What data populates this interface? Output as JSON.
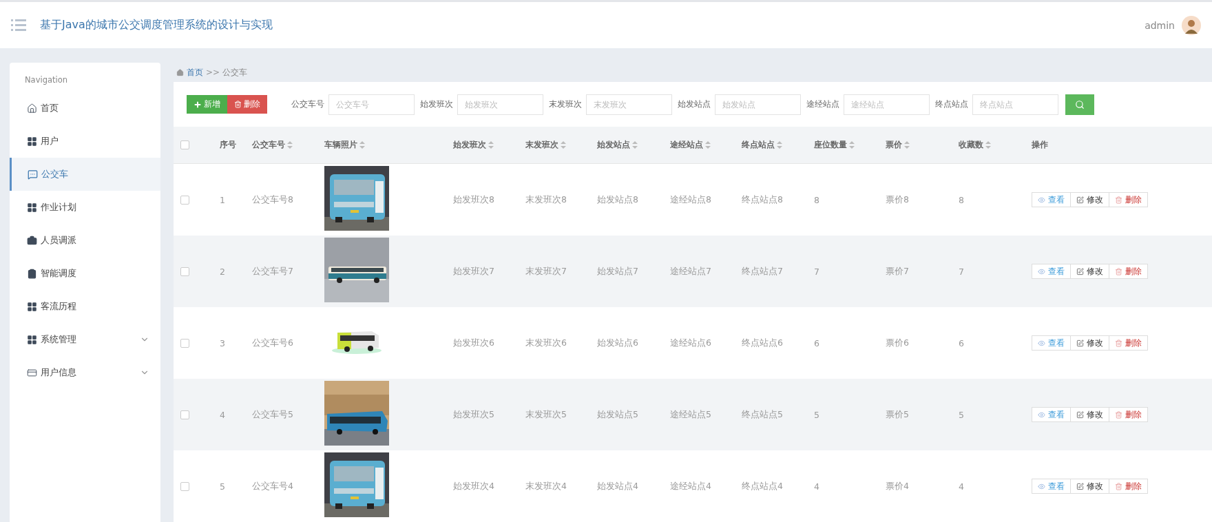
{
  "header": {
    "title": "基于Java的城市公交调度管理系统的设计与实现",
    "user": "admin"
  },
  "sidebar": {
    "heading": "Navigation",
    "items": [
      {
        "label": "首页",
        "selected": false,
        "expandable": false
      },
      {
        "label": "用户",
        "selected": false,
        "expandable": false
      },
      {
        "label": "公交车",
        "selected": true,
        "expandable": false
      },
      {
        "label": "作业计划",
        "selected": false,
        "expandable": false
      },
      {
        "label": "人员调派",
        "selected": false,
        "expandable": false
      },
      {
        "label": "智能调度",
        "selected": false,
        "expandable": false
      },
      {
        "label": "客流历程",
        "selected": false,
        "expandable": false
      },
      {
        "label": "系统管理",
        "selected": false,
        "expandable": true
      },
      {
        "label": "用户信息",
        "selected": false,
        "expandable": true
      }
    ]
  },
  "breadcrumb": {
    "home": "首页",
    "separator": ">>",
    "current": "公交车"
  },
  "toolbar": {
    "add": "新增",
    "delete": "删除",
    "filters": [
      {
        "label": "公交车号",
        "placeholder": "公交车号"
      },
      {
        "label": "始发班次",
        "placeholder": "始发班次"
      },
      {
        "label": "末发班次",
        "placeholder": "末发班次"
      },
      {
        "label": "始发站点",
        "placeholder": "始发站点"
      },
      {
        "label": "途经站点",
        "placeholder": "途经站点"
      },
      {
        "label": "终点站点",
        "placeholder": "终点站点"
      }
    ]
  },
  "table": {
    "select_all": {
      "checked": false
    },
    "columns": [
      {
        "label": "序号",
        "sortable": false
      },
      {
        "label": "公交车号",
        "sortable": true
      },
      {
        "label": "车辆照片",
        "sortable": true
      },
      {
        "label": "始发班次",
        "sortable": true
      },
      {
        "label": "末发班次",
        "sortable": true
      },
      {
        "label": "始发站点",
        "sortable": true
      },
      {
        "label": "途经站点",
        "sortable": true
      },
      {
        "label": "终点站点",
        "sortable": true
      },
      {
        "label": "座位数量",
        "sortable": true
      },
      {
        "label": "票价",
        "sortable": true
      },
      {
        "label": "收藏数",
        "sortable": true
      },
      {
        "label": "操作",
        "sortable": false
      }
    ],
    "rows": [
      {
        "checked": false,
        "cells": [
          "1",
          "公交车号8",
          {
            "kind": "picture"
          },
          "始发班次8",
          "末发班次8",
          "始发站点8",
          "途经站点8",
          "终点站点8",
          "8",
          "票价8",
          "8"
        ],
        "actions": [
          "查看",
          "修改",
          "删除"
        ]
      },
      {
        "checked": false,
        "cells": [
          "2",
          "公交车号7",
          {
            "kind": "picture"
          },
          "始发班次7",
          "末发班次7",
          "始发站点7",
          "途经站点7",
          "终点站点7",
          "7",
          "票价7",
          "7"
        ],
        "actions": [
          "查看",
          "修改",
          "删除"
        ]
      },
      {
        "checked": false,
        "cells": [
          "3",
          "公交车号6",
          {
            "kind": "picture"
          },
          "始发班次6",
          "末发班次6",
          "始发站点6",
          "途经站点6",
          "终点站点6",
          "6",
          "票价6",
          "6"
        ],
        "actions": [
          "查看",
          "修改",
          "删除"
        ]
      },
      {
        "checked": false,
        "cells": [
          "4",
          "公交车号5",
          {
            "kind": "picture"
          },
          "始发班次5",
          "末发班次5",
          "始发站点5",
          "途经站点5",
          "终点站点5",
          "5",
          "票价5",
          "5"
        ],
        "actions": [
          "查看",
          "修改",
          "删除"
        ]
      },
      {
        "checked": false,
        "cells": [
          "5",
          "公交车号4",
          {
            "kind": "picture"
          },
          "始发班次4",
          "末发班次4",
          "始发站点4",
          "途经站点4",
          "终点站点4",
          "4",
          "票价4",
          "4"
        ],
        "actions": [
          "查看",
          "修改",
          "删除"
        ]
      }
    ]
  }
}
